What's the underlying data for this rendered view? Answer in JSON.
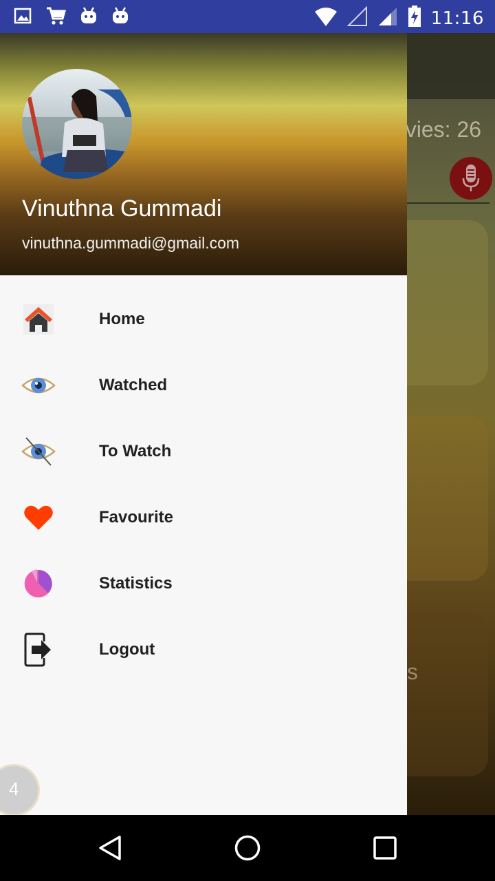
{
  "status_bar": {
    "time": "11:16",
    "left_icons": [
      "image-icon",
      "cart-icon",
      "android-icon",
      "android-icon"
    ],
    "right_icons": [
      "wifi-icon",
      "signal-empty-icon",
      "signal-icon",
      "battery-charging-icon"
    ]
  },
  "background": {
    "movie_count": "vies: 26",
    "partial_text": "s"
  },
  "drawer": {
    "user_name": "Vinuthna Gummadi",
    "user_email": "vinuthna.gummadi@gmail.com",
    "menu": [
      {
        "label": "Home",
        "icon": "home-icon"
      },
      {
        "label": "Watched",
        "icon": "eye-icon"
      },
      {
        "label": "To Watch",
        "icon": "eye-off-icon"
      },
      {
        "label": "Favourite",
        "icon": "heart-icon"
      },
      {
        "label": "Statistics",
        "icon": "pie-chart-icon"
      },
      {
        "label": "Logout",
        "icon": "logout-icon"
      }
    ],
    "badge_count": "4"
  },
  "colors": {
    "status_bar": "#303f9f",
    "home_roof": "#e8542a",
    "eye_iris": "#5b8fd8",
    "heart": "#ff3d00",
    "pie_pink": "#f060b0",
    "pie_purple": "#a050d0"
  }
}
